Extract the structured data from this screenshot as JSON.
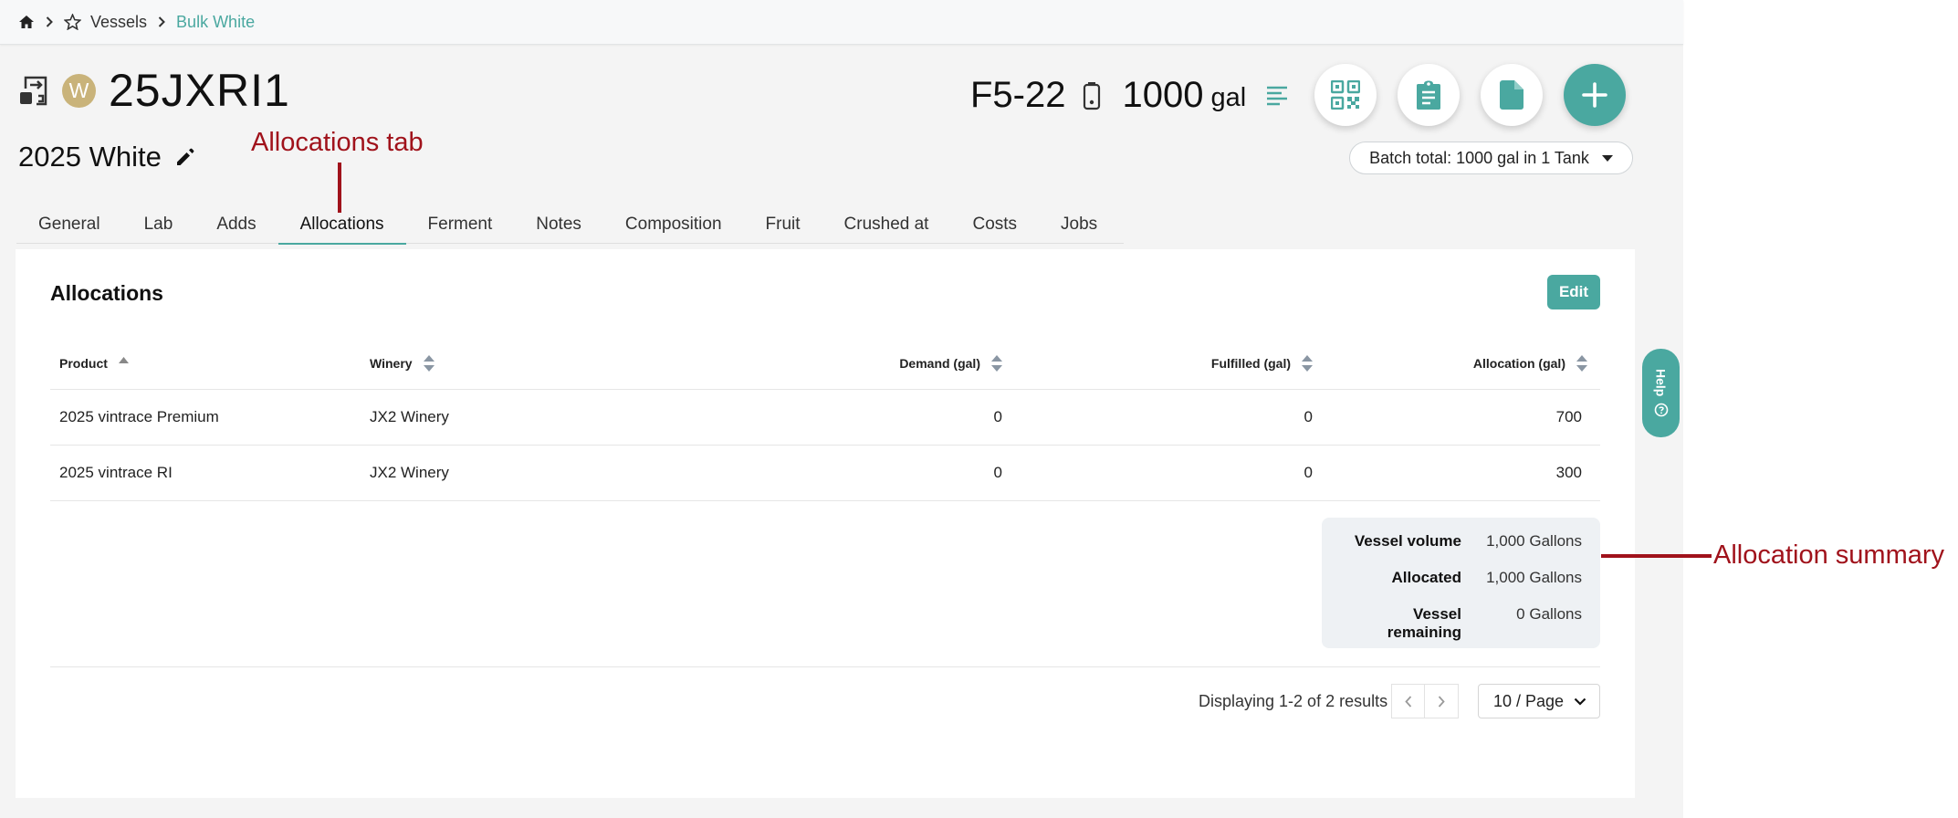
{
  "breadcrumb": {
    "vessels": "Vessels",
    "current": "Bulk White"
  },
  "header": {
    "batch_code": "25JXRI1",
    "badge_letter": "W",
    "subtitle": "2025 White",
    "vessel_code": "F5-22",
    "volume": "1000",
    "volume_unit": "gal",
    "batch_total": "Batch total: 1000 gal in 1 Tank"
  },
  "tabs": [
    "General",
    "Lab",
    "Adds",
    "Allocations",
    "Ferment",
    "Notes",
    "Composition",
    "Fruit",
    "Crushed at",
    "Costs",
    "Jobs"
  ],
  "active_tab": "Allocations",
  "panel": {
    "title": "Allocations",
    "edit_label": "Edit"
  },
  "table": {
    "headers": {
      "product": "Product",
      "winery": "Winery",
      "demand": "Demand (gal)",
      "fulfilled": "Fulfilled (gal)",
      "allocation": "Allocation (gal)"
    },
    "rows": [
      {
        "product": "2025 vintrace Premium",
        "winery": "JX2 Winery",
        "demand": "0",
        "fulfilled": "0",
        "allocation": "700"
      },
      {
        "product": "2025 vintrace RI",
        "winery": "JX2 Winery",
        "demand": "0",
        "fulfilled": "0",
        "allocation": "300"
      }
    ]
  },
  "summary": {
    "vessel_volume_label": "Vessel volume",
    "vessel_volume_value": "1,000 Gallons",
    "allocated_label": "Allocated",
    "allocated_value": "1,000 Gallons",
    "remaining_label": "Vessel remaining",
    "remaining_value": "0 Gallons"
  },
  "pagination": {
    "results_text": "Displaying 1-2 of 2 results",
    "per_page": "10 / Page"
  },
  "help_label": "Help",
  "annotations": {
    "tab": "Allocations tab",
    "summary": "Allocation summary"
  },
  "colors": {
    "accent": "#4aa8a0",
    "annotation": "#a0121b",
    "badge": "#c9b37a"
  }
}
